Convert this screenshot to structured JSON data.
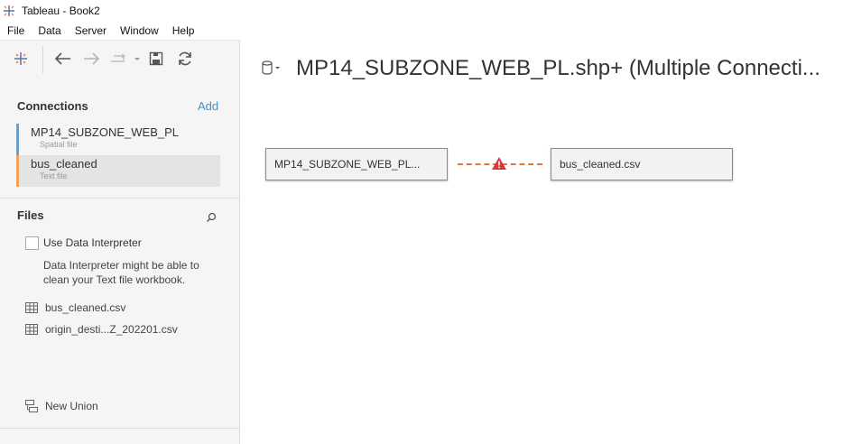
{
  "window": {
    "title": "Tableau - Book2"
  },
  "menu": [
    "File",
    "Data",
    "Server",
    "Window",
    "Help"
  ],
  "sidebar": {
    "connections_title": "Connections",
    "add_label": "Add",
    "connections": [
      {
        "name": "MP14_SUBZONE_WEB_PL",
        "type": "Spatial file"
      },
      {
        "name": "bus_cleaned",
        "type": "Text file"
      }
    ],
    "files_title": "Files",
    "use_interpreter_label": "Use Data Interpreter",
    "interpreter_note": "Data Interpreter might be able to clean your Text file workbook.",
    "files": [
      "bus_cleaned.csv",
      "origin_desti...Z_202201.csv"
    ],
    "new_union_label": "New Union"
  },
  "main": {
    "datasource_title": "MP14_SUBZONE_WEB_PL.shp+ (Multiple Connecti...",
    "left_table": "MP14_SUBZONE_WEB_PL...",
    "right_table": "bus_cleaned.csv"
  },
  "colors": {
    "accent_blue": "#4a8fc4",
    "conn_blue": "#6c9fc5",
    "conn_orange": "#f1a25f",
    "join_orange": "#e07a3c",
    "warning_red": "#d9363e"
  }
}
